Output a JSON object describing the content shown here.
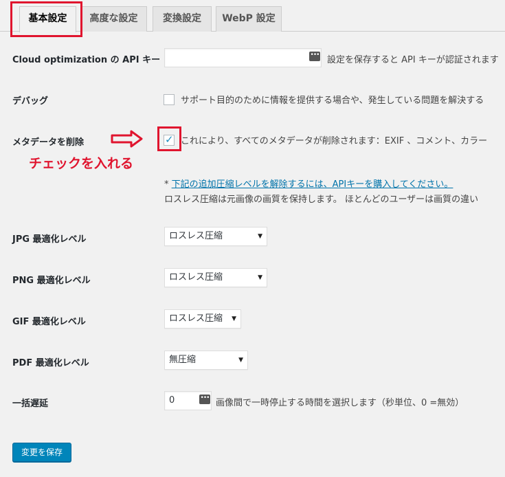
{
  "tabs": [
    {
      "label": "基本設定"
    },
    {
      "label": "高度な設定"
    },
    {
      "label": "変換設定"
    },
    {
      "label": "WebP 設定"
    }
  ],
  "api_key": {
    "label": "Cloud optimization の API キー",
    "value": "",
    "icon": "key-dots-icon",
    "help": "設定を保存すると API キーが認証されます"
  },
  "debug": {
    "label": "デバッグ",
    "checked": false,
    "description": "サポート目的のために情報を提供する場合や、発生している問題を解決する"
  },
  "metadata": {
    "label": "メタデータを削除",
    "checked": true,
    "description": "これにより、すべてのメタデータが削除されます：EXIF 、コメント、カラー"
  },
  "annotation": {
    "text": "チェックを入れる",
    "color": "#e0142e"
  },
  "notice": {
    "prefix": "* ",
    "link_text": "下記の追加圧縮レベルを解除するには、APIキーを購入してください。",
    "line2": "ロスレス圧縮は元画像の画質を保持します。 ほとんどのユーザーは画質の違い"
  },
  "jpg": {
    "label": "JPG 最適化レベル",
    "selected": "ロスレス圧縮"
  },
  "png": {
    "label": "PNG 最適化レベル",
    "selected": "ロスレス圧縮"
  },
  "gif": {
    "label": "GIF 最適化レベル",
    "selected": "ロスレス圧縮"
  },
  "pdf": {
    "label": "PDF 最適化レベル",
    "selected": "無圧縮"
  },
  "delay": {
    "label": "一括遅延",
    "value": "0",
    "description": "画像間で一時停止する時間を選択します（秒単位、0 =無効）"
  },
  "save_button": "変更を保存",
  "colors": {
    "accent": "#0085ba",
    "highlight": "#e0142e",
    "link": "#0073aa"
  }
}
